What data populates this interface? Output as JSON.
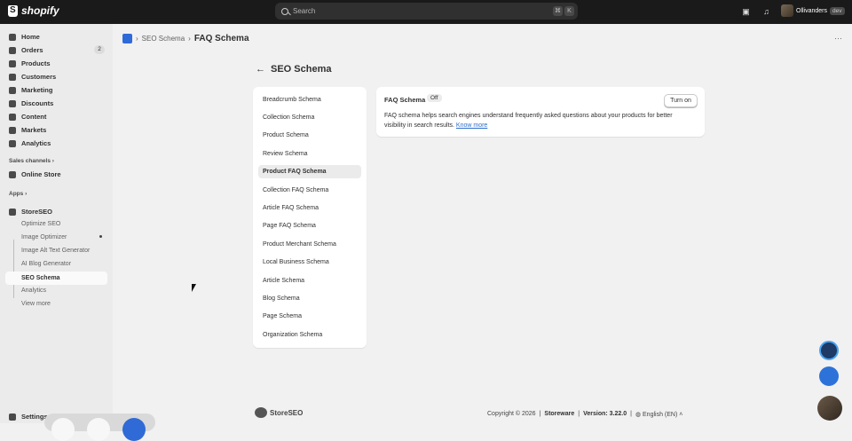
{
  "topbar": {
    "brand": "shopify",
    "search_placeholder": "Search",
    "shortcut_keys": [
      "⌘",
      "K"
    ],
    "store_name": "Ollivanders",
    "store_badge": "dev"
  },
  "sidebar": {
    "items": [
      {
        "label": "Home",
        "icon": "home-icon"
      },
      {
        "label": "Orders",
        "icon": "orders-icon",
        "badge": "2"
      },
      {
        "label": "Products",
        "icon": "tag-icon"
      },
      {
        "label": "Customers",
        "icon": "person-icon"
      },
      {
        "label": "Marketing",
        "icon": "target-icon"
      },
      {
        "label": "Discounts",
        "icon": "discount-icon"
      },
      {
        "label": "Content",
        "icon": "content-icon"
      },
      {
        "label": "Markets",
        "icon": "globe-icon"
      },
      {
        "label": "Analytics",
        "icon": "chart-icon"
      }
    ],
    "sales_channels_label": "Sales channels",
    "online_store_label": "Online Store",
    "apps_label": "Apps",
    "app_name": "StoreSEO",
    "app_subitems": [
      "Optimize SEO",
      "Image Optimizer",
      "Image Alt Text Generator",
      "AI Blog Generator",
      "SEO Schema",
      "Analytics",
      "View more"
    ],
    "settings_label": "Settings"
  },
  "breadcrumb": {
    "parent": "SEO Schema",
    "current": "FAQ Schema",
    "separator": "›"
  },
  "page": {
    "title": "SEO Schema",
    "schema_items": [
      "Breadcrumb Schema",
      "Collection Schema",
      "Product Schema",
      "Review Schema",
      "Product FAQ Schema",
      "Collection FAQ Schema",
      "Article FAQ Schema",
      "Page FAQ Schema",
      "Product Merchant Schema",
      "Local Business Schema",
      "Article Schema",
      "Blog Schema",
      "Page Schema",
      "Organization Schema"
    ],
    "active_schema": "Product FAQ Schema"
  },
  "faq_card": {
    "title": "FAQ Schema",
    "status": "Off",
    "description": "FAQ schema helps search engines understand frequently asked questions about your products for better visibility in search results.",
    "link": "Know more",
    "button": "Turn on"
  },
  "footer": {
    "brand": "StoreSEO",
    "copyright": "Copyright © 2026",
    "company": "Storeware",
    "version": "Version: 3.22.0",
    "language": "English (EN)"
  }
}
